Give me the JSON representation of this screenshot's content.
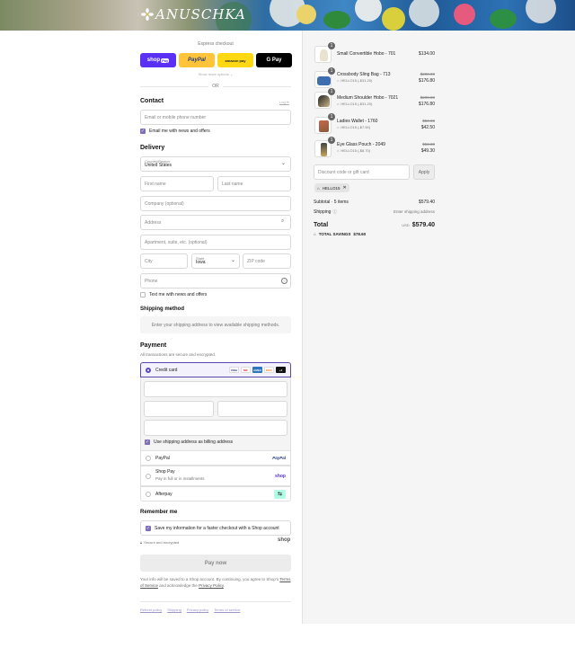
{
  "brand": {
    "logo_text": "ANUSCHKA"
  },
  "express": {
    "title": "Express checkout",
    "shop_pay": "shop",
    "shop_pay_suffix": "Pay",
    "paypal": "PayPal",
    "amazon_pay": "amazon pay",
    "google_pay": "G Pay",
    "more": "Show more options ⌄",
    "or": "OR"
  },
  "contact": {
    "heading": "Contact",
    "login": "Log in",
    "email_placeholder": "Email or mobile phone number",
    "news_label": "Email me with news and offers"
  },
  "delivery": {
    "heading": "Delivery",
    "country_label": "Country/Region",
    "country_value": "United States",
    "first_name": "First name",
    "last_name": "Last name",
    "company": "Company (optional)",
    "address": "Address",
    "apartment": "Apartment, suite, etc. (optional)",
    "city": "City",
    "state_label": "State",
    "state_value": "Iowa",
    "zip": "ZIP code",
    "phone": "Phone",
    "text_label": "Text me with news and offers"
  },
  "shipping_method": {
    "heading": "Shipping method",
    "note": "Enter your shipping address to view available shipping methods."
  },
  "payment": {
    "heading": "Payment",
    "subtitle": "All transactions are secure and encrypted.",
    "credit_card": "Credit card",
    "billing_same": "Use shipping address as billing address",
    "paypal": "PayPal",
    "paypal_logo": "PayPal",
    "shop_pay": "Shop Pay",
    "shop_pay_sub": "Pay in full or in installments",
    "shop_pay_logo": "shop",
    "afterpay": "Afterpay",
    "card_brands": [
      "VISA",
      "MC",
      "AMEX",
      "DISC",
      "+4"
    ]
  },
  "remember": {
    "heading": "Remember me",
    "save_label": "Save my information for a faster checkout with a Shop account",
    "secure": "Secure and encrypted",
    "shop_logo": "shop"
  },
  "pay_now": "Pay now",
  "legal": {
    "text_1": "Your info will be saved to a Shop account. By continuing, you agree to Shop’s",
    "terms": "Terms of Service",
    "text_2": "and acknowledge the",
    "privacy": "Privacy Policy",
    "text_3": "."
  },
  "footer": {
    "links": [
      "Refund policy",
      "Shipping",
      "Privacy policy",
      "Terms of service"
    ]
  },
  "order": {
    "items": [
      {
        "qty": "1",
        "name": "Small Convertible Hobo - 701",
        "code": "",
        "price": "$134.00",
        "original": ""
      },
      {
        "qty": "1",
        "name": "Crossbody Sling Bag - 713",
        "code": "HELLO15 (-$31.20)",
        "price": "$176.80",
        "original": "$208.00"
      },
      {
        "qty": "1",
        "name": "Medium Shoulder Hobo - 7021",
        "code": "HELLO15 (-$31.20)",
        "price": "$176.80",
        "original": "$208.00"
      },
      {
        "qty": "1",
        "name": "Ladies Wallet - 1760",
        "code": "HELLO15 (-$7.50)",
        "price": "$42.50",
        "original": "$50.00"
      },
      {
        "qty": "1",
        "name": "Eye Glass Pouch - 2049",
        "code": "HELLO15 (-$8.70)",
        "price": "$49.30",
        "original": "$58.00"
      }
    ],
    "discount_placeholder": "Discount code or gift card",
    "apply": "Apply",
    "applied_code": "HELLO15",
    "subtotal_label": "Subtotal · 5 items",
    "subtotal_value": "$579.40",
    "shipping_label": "Shipping",
    "shipping_value": "Enter shipping address",
    "total_label": "Total",
    "total_currency": "USD",
    "total_value": "$579.40",
    "savings_label": "TOTAL SAVINGS",
    "savings_value": "$78.60"
  },
  "colors": {
    "accent": "#5a4ab0",
    "shop_pay": "#5a31f4",
    "paypal": "#ffc439",
    "amazon": "#ffd814"
  }
}
